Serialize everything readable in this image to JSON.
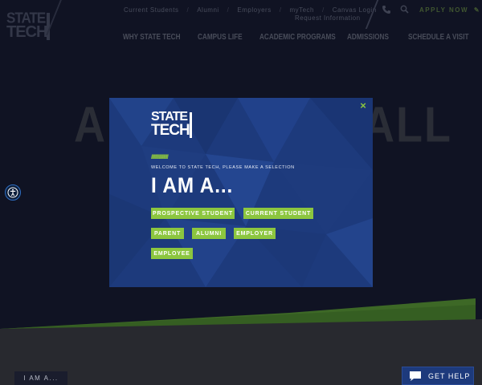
{
  "logo": {
    "line1": "STATE",
    "line2": "TECH"
  },
  "utility_nav": [
    "Current Students",
    "Alumni",
    "Employers",
    "myTech",
    "Canvas Login"
  ],
  "utility_request": "Request Information",
  "apply_now": "APPLY NOW",
  "main_nav": [
    "WHY STATE TECH",
    "CAMPUS LIFE",
    "ACADEMIC PROGRAMS",
    "ADMISSIONS",
    "SCHEDULE A VISIT"
  ],
  "hero": {
    "text_left": "AP",
    "text_right": "ALL"
  },
  "modal": {
    "logo_line1": "STATE",
    "logo_line2": "TECH",
    "slashes": "//////////////////////",
    "welcome": "WELCOME TO STATE TECH, PLEASE MAKE A SELECTION",
    "heading": "I AM A...",
    "close": "×",
    "options": [
      "PROSPECTIVE STUDENT",
      "CURRENT STUDENT",
      "PARENT",
      "ALUMNI",
      "EMPLOYER",
      "EMPLOYEE"
    ]
  },
  "iam_tab": "I AM A...",
  "get_help": "GET HELP",
  "colors": {
    "accent_green": "#8cc63f",
    "modal_blue": "#1d3a7c",
    "hero_dark": "#14172a"
  },
  "icons": [
    "phone-icon",
    "search-icon",
    "pencil-icon",
    "accessibility-icon",
    "close-icon",
    "chat-icon"
  ]
}
